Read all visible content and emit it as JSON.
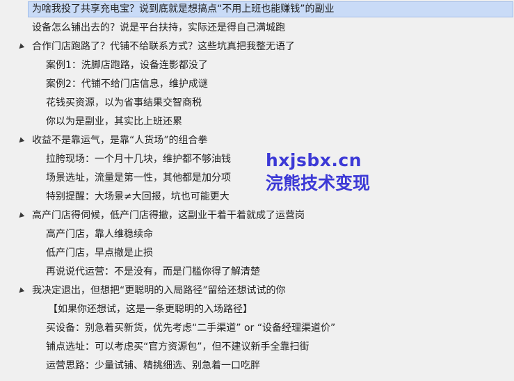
{
  "outline": {
    "rows": [
      {
        "text": "为啥我投了共享充电宝？说到底就是想搞点“不用上班也能赚钱”的副业"
      },
      {
        "text": "设备怎么铺出去的？说是平台扶持，实际还是得自己满城跑"
      },
      {
        "text": "合作门店跑路了？代铺不给联系方式？这些坑真把我整无语了"
      },
      {
        "text": "案例1：洗脚店跑路，设备连影都没了"
      },
      {
        "text": "案例2：代铺不给门店信息，维护成谜"
      },
      {
        "text": "花钱买资源，以为省事结果交智商税"
      },
      {
        "text": "你以为是副业，其实比上班还累"
      },
      {
        "text": "收益不是靠运气，是靠“人货场”的组合拳"
      },
      {
        "text": "拉胯现场：一个月十几块，维护都不够油钱"
      },
      {
        "text": "场景选址，流量是第一性，其他都是加分项"
      },
      {
        "text": "特别提醒：大场景≠大回报，坑也可能更大"
      },
      {
        "text": "高产门店得伺候，低产门店得撤，这副业干着干着就成了运营岗"
      },
      {
        "text": "高产门店，靠人维稳续命"
      },
      {
        "text": "低产门店，早点撤是止损"
      },
      {
        "text": "再说说代运营：不是没有，而是门槛你得了解清楚"
      },
      {
        "text": "我决定退出，但想把“更聪明的入局路径”留给还想试试的你"
      },
      {
        "text": "【如果你还想试，这是一条更聪明的入场路径】"
      },
      {
        "text": "买设备：别急着买新货，优先考虑“二手渠道” or “设备经理渠道价”"
      },
      {
        "text": "铺点选址：可以考虑买“官方资源包”，但不建议新手全靠扫街"
      },
      {
        "text": "运营思路：少量试铺、精挑细选、别急着一口吃胖"
      }
    ]
  },
  "watermark": {
    "line1": "hxjsbx.cn",
    "line2": "浣熊技术变现",
    "color": "#3c39d6"
  },
  "colors": {
    "background": "#f0f0f0",
    "selection": "#c9dbf7",
    "text": "#222222"
  },
  "icons": {
    "caret": "expanded-triangle-icon"
  }
}
